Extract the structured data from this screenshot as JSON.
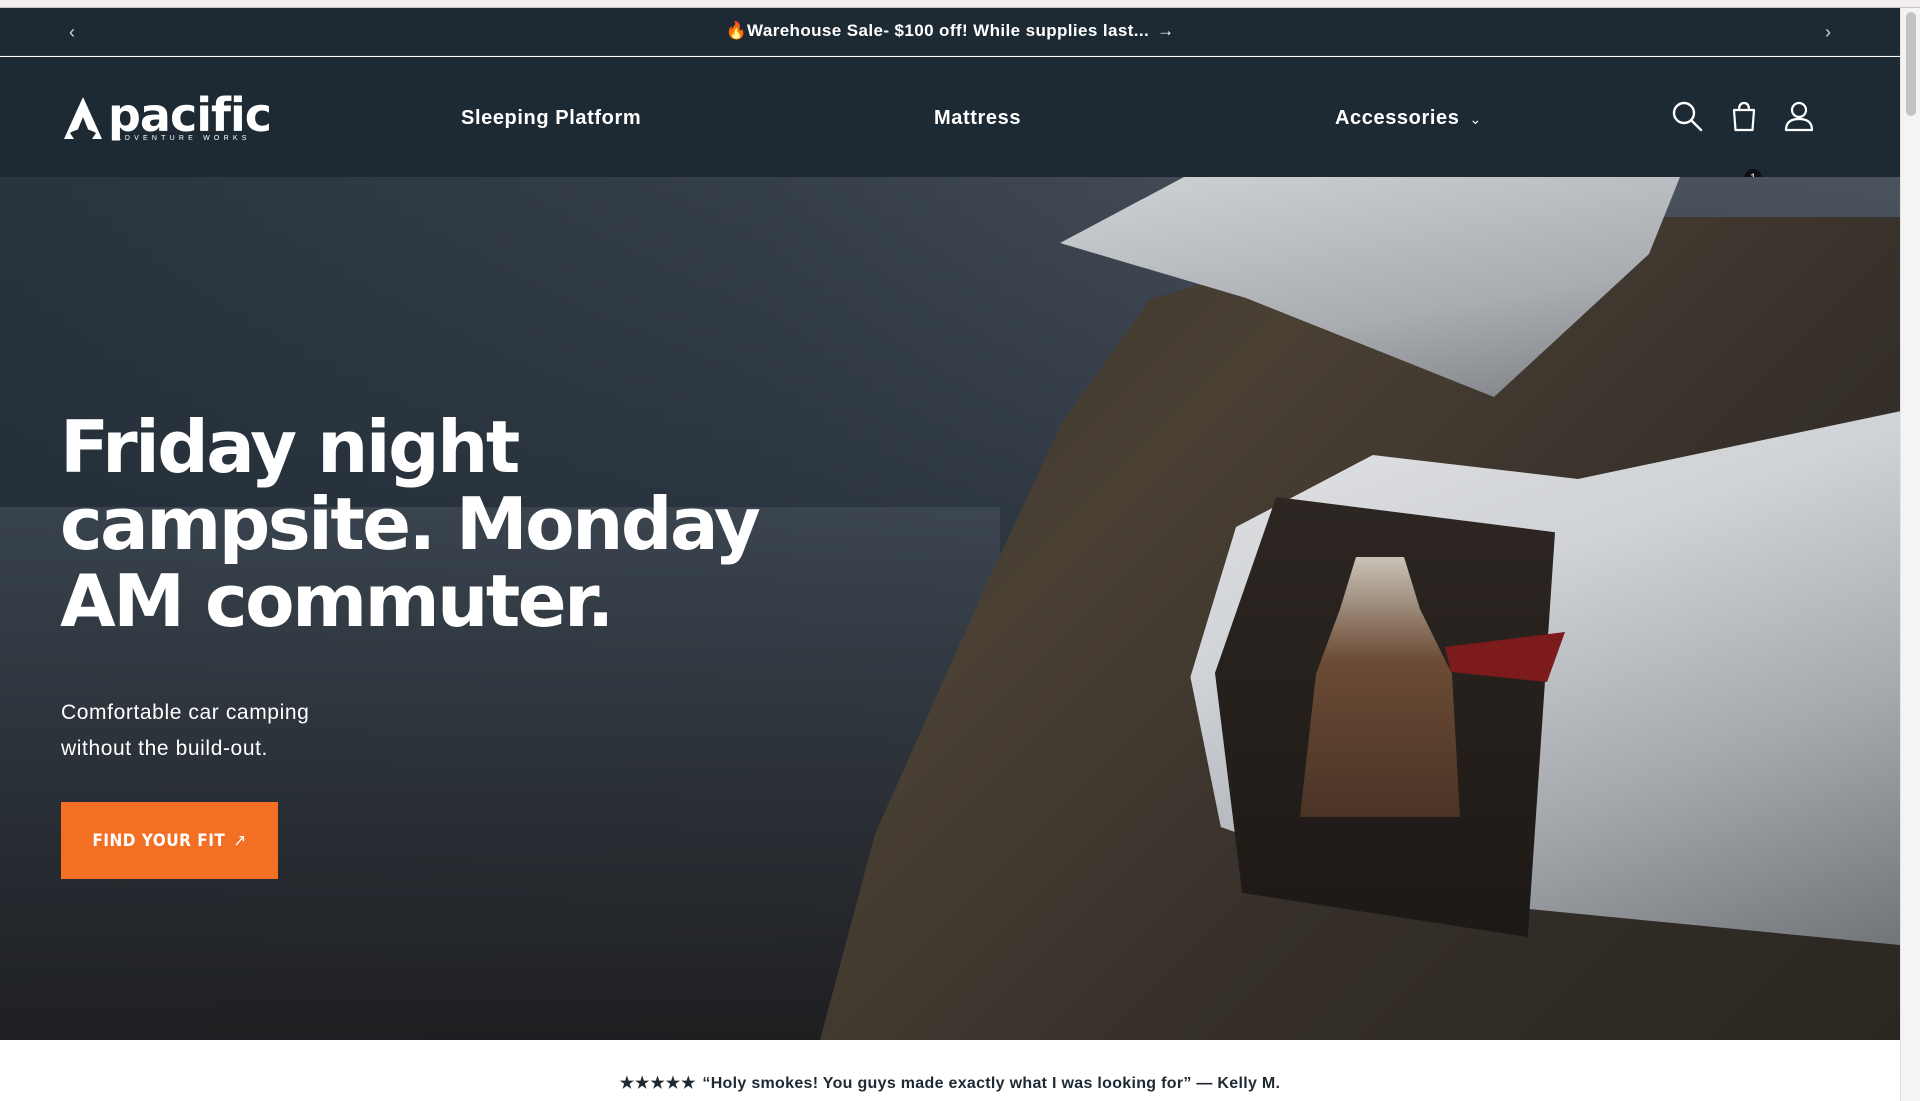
{
  "announcement": {
    "prev_icon": "chevron-left-icon",
    "next_icon": "chevron-right-icon",
    "text": "🔥Warehouse Sale- $100 off! While supplies last...",
    "arrow": "→"
  },
  "header": {
    "logo": {
      "brand": "pacific",
      "tagline": "ADVENTURE WORKS"
    },
    "nav": [
      {
        "label": "Sleeping Platform"
      },
      {
        "label": "Mattress"
      },
      {
        "label": "Accessories",
        "chevron": "⌄"
      }
    ],
    "icons": [
      "search-icon",
      "cart-icon",
      "account-icon"
    ],
    "cart_count": "1"
  },
  "hero": {
    "heading": "Friday night campsite. Monday AM commuter.",
    "subtitle": "Comfortable car camping without the build-out.",
    "cta_label": "FIND YOUR FIT",
    "cta_arrow": "↗"
  },
  "testimonial": {
    "stars": "★★★★★",
    "quote": "“Holy smokes! You guys made exactly what I was looking for” — Kelly M."
  },
  "colors": {
    "header_bg": "#1d2a34",
    "cta_orange": "#f26f23",
    "white": "#ffffff"
  }
}
